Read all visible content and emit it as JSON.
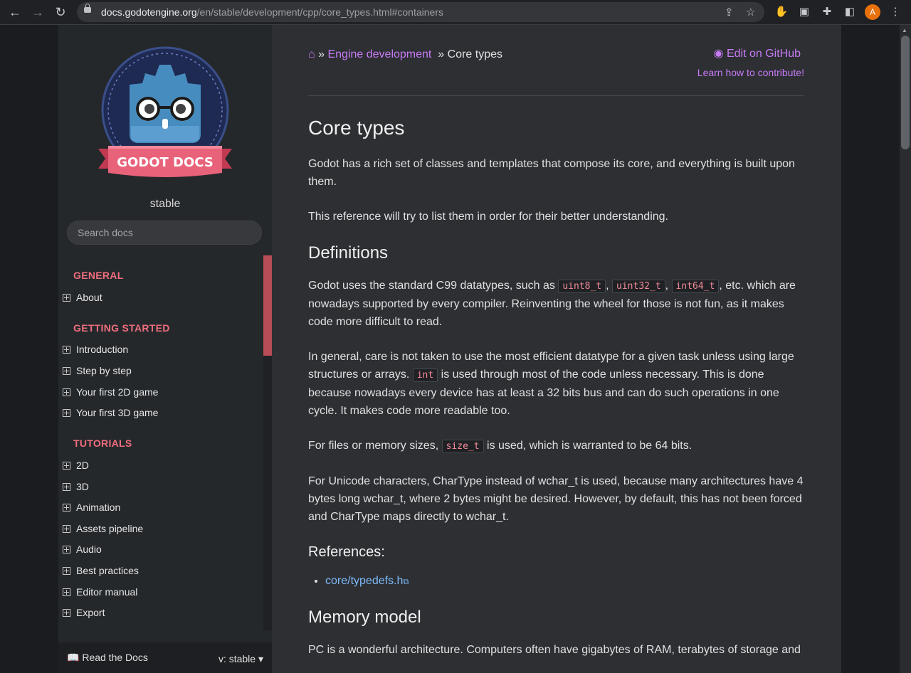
{
  "browser": {
    "url_host": "docs.godotengine.org",
    "url_path": "/en/stable/development/cpp/core_types.html#containers",
    "avatar_letter": "A",
    "accent": "#e8710a"
  },
  "sidebar": {
    "logo_text": "GODOT DOCS",
    "version": "stable",
    "search_placeholder": "Search docs",
    "sections": [
      {
        "title": "GENERAL",
        "items": [
          "About"
        ]
      },
      {
        "title": "GETTING STARTED",
        "items": [
          "Introduction",
          "Step by step",
          "Your first 2D game",
          "Your first 3D game"
        ]
      },
      {
        "title": "TUTORIALS",
        "items": [
          "2D",
          "3D",
          "Animation",
          "Assets pipeline",
          "Audio",
          "Best practices",
          "Editor manual",
          "Export"
        ]
      }
    ],
    "read_the_docs": "Read the Docs",
    "version_select": "v: stable"
  },
  "header": {
    "breadcrumb_sep": "»",
    "breadcrumb_link": "Engine development",
    "breadcrumb_current": "Core types",
    "edit_github": "Edit on GitHub",
    "contribute": "Learn how to contribute!"
  },
  "article": {
    "title": "Core types",
    "intro_1": "Godot has a rich set of classes and templates that compose its core, and everything is built upon them.",
    "intro_2": "This reference will try to list them in order for their better understanding.",
    "definitions_title": "Definitions",
    "def_p1_a": "Godot uses the standard C99 datatypes, such as",
    "code_uint8": "uint8_t",
    "code_uint32": "uint32_t",
    "code_int64": "int64_t",
    "def_p1_b": ", etc. which are nowadays supported by every compiler. Reinventing the wheel for those is not fun, as it makes code more difficult to read.",
    "def_p2_a": "In general, care is not taken to use the most efficient datatype for a given task unless using large structures or arrays.",
    "code_int": "int",
    "def_p2_b": "is used through most of the code unless necessary. This is done because nowadays every device has at least a 32 bits bus and can do such operations in one cycle. It makes code more readable too.",
    "def_p3_a": "For files or memory sizes,",
    "code_size": "size_t",
    "def_p3_b": "is used, which is warranted to be 64 bits.",
    "def_p4": "For Unicode characters, CharType instead of wchar_t is used, because many architectures have 4 bytes long wchar_t, where 2 bytes might be desired. However, by default, this has not been forced and CharType maps directly to wchar_t.",
    "references_title": "References:",
    "reference_link": "core/typedefs.h",
    "memory_title": "Memory model",
    "memory_p1": "PC is a wonderful architecture. Computers often have gigabytes of RAM, terabytes of storage and"
  }
}
